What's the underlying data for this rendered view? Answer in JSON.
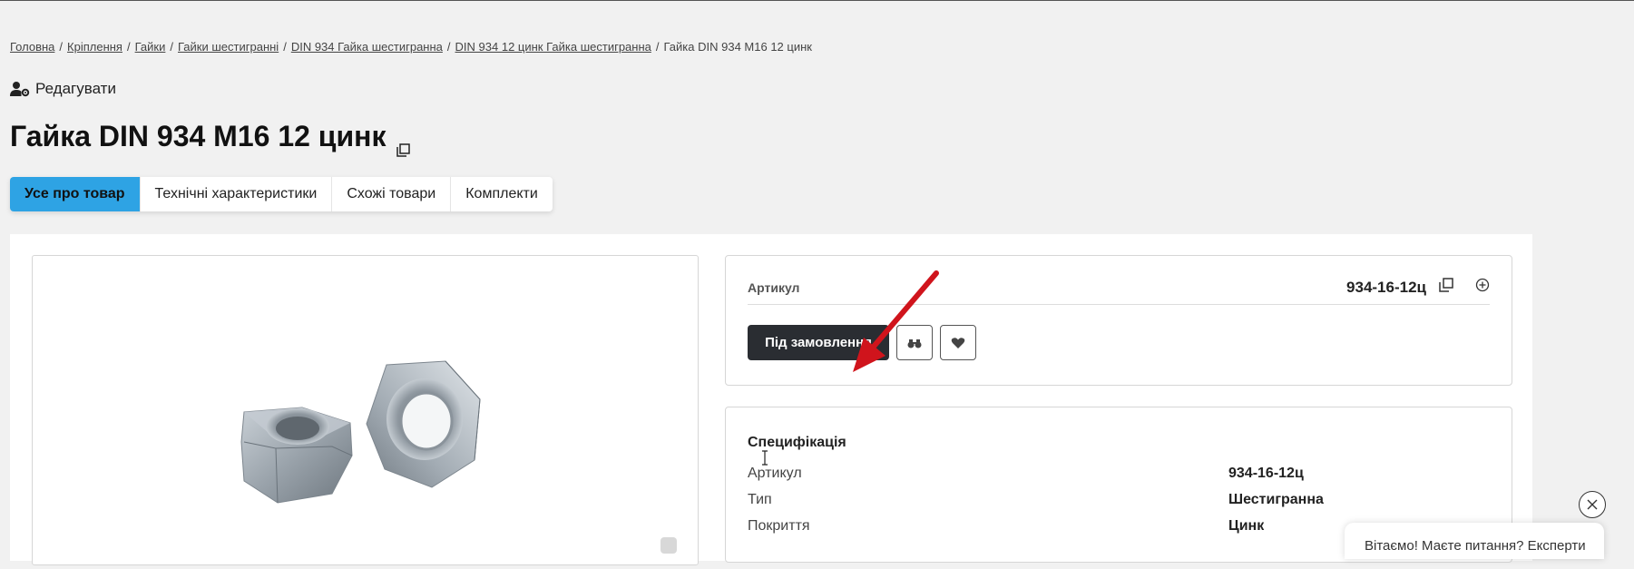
{
  "breadcrumb": {
    "items": [
      "Головна",
      "Кріплення",
      "Гайки",
      "Гайки шестигранні",
      "DIN 934 Гайка шестигранна",
      "DIN 934 12 цинк Гайка шестигранна"
    ],
    "current": "Гайка DIN 934 М16 12 цинк",
    "separator": "/"
  },
  "edit": {
    "label": "Редагувати",
    "icon": "user-gear-icon"
  },
  "page_title": "Гайка DIN 934 М16 12 цинк",
  "tabs": [
    {
      "label": "Усе про товар",
      "active": true
    },
    {
      "label": "Технічні характеристики",
      "active": false
    },
    {
      "label": "Схожі товари",
      "active": false
    },
    {
      "label": "Комплекти",
      "active": false
    }
  ],
  "product": {
    "sku_label": "Артикул",
    "sku_value": "934-16-12ц",
    "order_button": "Під замовлення",
    "compare_icon": "binoculars-icon",
    "favorite_icon": "heart-icon"
  },
  "spec": {
    "title": "Специфікація",
    "rows": [
      {
        "key": "Артикул",
        "value": "934-16-12ц"
      },
      {
        "key": "Тип",
        "value": "Шестигранна"
      },
      {
        "key": "Покриття",
        "value": "Цинк"
      }
    ]
  },
  "chat": {
    "text": "Вітаємо! Маєте питання? Експерти"
  },
  "colors": {
    "accent": "#2ea3e4",
    "dark_button": "#2a2d32",
    "arrow": "#d0141c",
    "background": "#f1f1f1"
  }
}
